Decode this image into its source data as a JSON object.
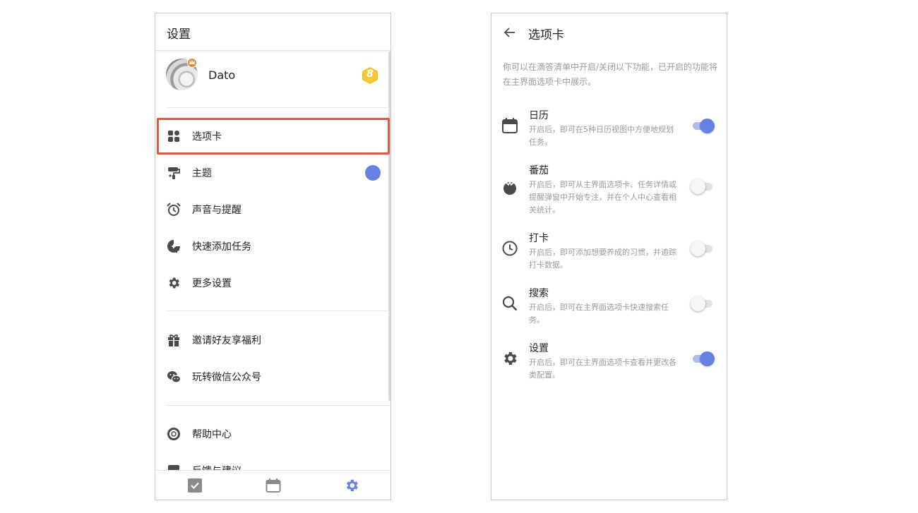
{
  "settings_screen": {
    "title": "设置",
    "profile": {
      "username": "Dato",
      "level": "8"
    },
    "menu_group_1": [
      {
        "label": "选项卡",
        "icon": "tabs-grid-icon"
      },
      {
        "label": "主题",
        "icon": "paint-roller-icon"
      },
      {
        "label": "声音与提醒",
        "icon": "alarm-clock-icon"
      },
      {
        "label": "快速添加任务",
        "icon": "quick-add-icon"
      },
      {
        "label": "更多设置",
        "icon": "gear-icon"
      }
    ],
    "menu_group_2": [
      {
        "label": "邀请好友享福利",
        "icon": "gift-icon"
      },
      {
        "label": "玩转微信公众号",
        "icon": "wechat-icon"
      }
    ],
    "menu_group_3": [
      {
        "label": "帮助中心",
        "icon": "lifebuoy-icon"
      },
      {
        "label": "反馈与建议",
        "icon": "feedback-icon"
      }
    ],
    "theme_color": "#6582e0",
    "highlight_color": "#dd5846",
    "bottom_nav": [
      "tasks-icon",
      "calendar-icon",
      "settings-icon"
    ]
  },
  "tabs_screen": {
    "title": "选项卡",
    "description": "你可以在滴答清单中开启/关闭以下功能，已开启的功能将在主界面选项卡中展示。",
    "features": [
      {
        "title": "日历",
        "description": "开启后，即可在5种日历视图中方便地规划任务。",
        "enabled": true,
        "icon": "calendar-icon"
      },
      {
        "title": "番茄",
        "description": "开启后，即可从主界面选项卡、任务详情或提醒弹窗中开始专注，并在个人中心查看相关统计。",
        "enabled": false,
        "icon": "tomato-icon"
      },
      {
        "title": "打卡",
        "description": "开启后，即可添加想要养成的习惯，并追踪打卡数据。",
        "enabled": false,
        "icon": "clock-icon"
      },
      {
        "title": "搜索",
        "description": "开启后，即可在主界面选项卡快速搜索任务。",
        "enabled": false,
        "icon": "search-icon"
      },
      {
        "title": "设置",
        "description": "开启后，即可在主界面选项卡查看并更改各类配置。",
        "enabled": true,
        "icon": "gear-icon"
      }
    ],
    "accent_color": "#6582e0"
  }
}
